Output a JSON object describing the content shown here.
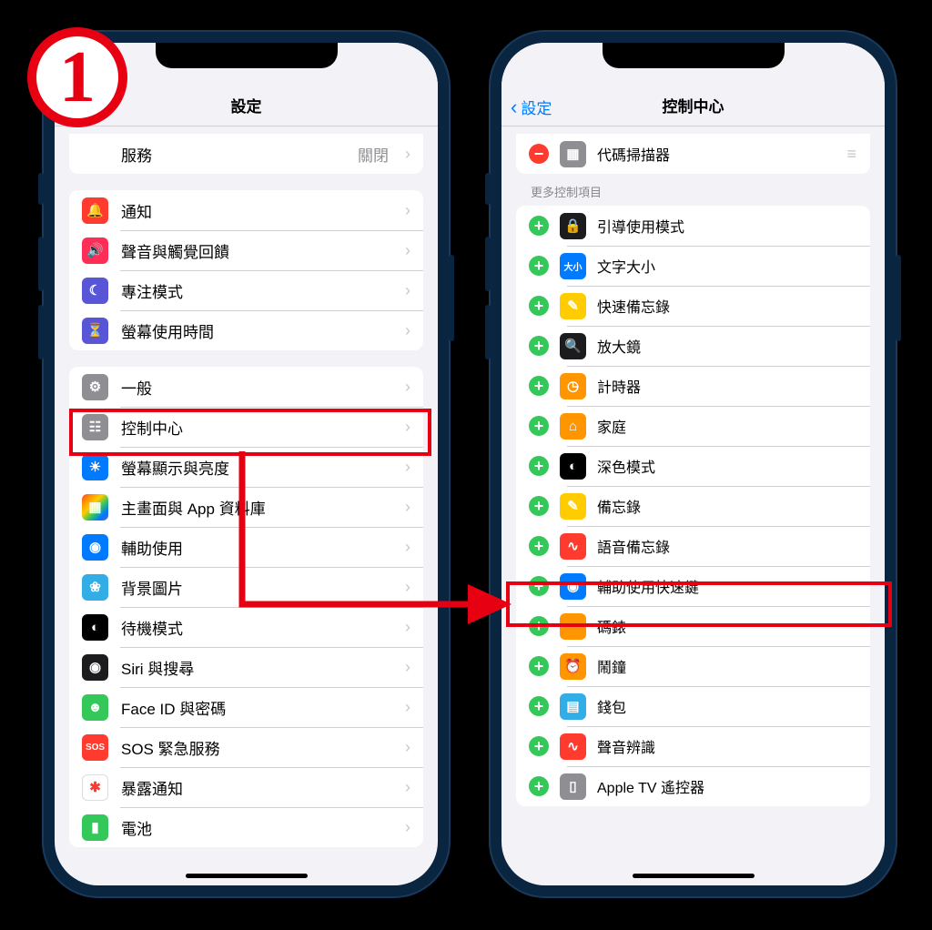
{
  "annotation": {
    "badge_number": "1"
  },
  "left_phone": {
    "title": "設定",
    "partial_row": {
      "label": "服務",
      "value": "關閉"
    },
    "group1": [
      {
        "label": "通知",
        "icon": "bell-icon",
        "color": "ic-red"
      },
      {
        "label": "聲音與觸覺回饋",
        "icon": "speaker-icon",
        "color": "ic-pink"
      },
      {
        "label": "專注模式",
        "icon": "moon-icon",
        "color": "ic-purple"
      },
      {
        "label": "螢幕使用時間",
        "icon": "hourglass-icon",
        "color": "ic-purple"
      }
    ],
    "group2": [
      {
        "label": "一般",
        "icon": "gear-icon",
        "color": "ic-gray"
      },
      {
        "label": "控制中心",
        "icon": "switches-icon",
        "color": "ic-gray",
        "highlight": true
      },
      {
        "label": "螢幕顯示與亮度",
        "icon": "brightness-icon",
        "color": "ic-blue"
      },
      {
        "label": "主畫面與 App 資料庫",
        "icon": "grid-icon",
        "color": "ic-multi"
      },
      {
        "label": "輔助使用",
        "icon": "accessibility-icon",
        "color": "ic-blue"
      },
      {
        "label": "背景圖片",
        "icon": "flower-icon",
        "color": "ic-teal"
      },
      {
        "label": "待機模式",
        "icon": "standby-icon",
        "color": "ic-black"
      },
      {
        "label": "Siri 與搜尋",
        "icon": "siri-icon",
        "color": "ic-dark"
      },
      {
        "label": "Face ID 與密碼",
        "icon": "faceid-icon",
        "color": "ic-green"
      },
      {
        "label": "SOS 緊急服務",
        "icon": "sos-icon",
        "color": "ic-red",
        "text": "SOS"
      },
      {
        "label": "暴露通知",
        "icon": "exposure-icon",
        "color": "ic-white"
      },
      {
        "label": "電池",
        "icon": "battery-icon",
        "color": "ic-green"
      }
    ]
  },
  "right_phone": {
    "back_label": "設定",
    "title": "控制中心",
    "included": [
      {
        "label": "代碼掃描器",
        "icon": "qr-icon",
        "color": "ic-gray",
        "action": "remove"
      }
    ],
    "more_section_label": "更多控制項目",
    "more": [
      {
        "label": "引導使用模式",
        "icon": "lock-icon",
        "color": "ic-dark"
      },
      {
        "label": "文字大小",
        "icon": "text-size-icon",
        "color": "ic-blue",
        "text": "大小"
      },
      {
        "label": "快速備忘錄",
        "icon": "quicknote-icon",
        "color": "ic-yellow"
      },
      {
        "label": "放大鏡",
        "icon": "magnifier-icon",
        "color": "ic-dark"
      },
      {
        "label": "計時器",
        "icon": "timer-icon",
        "color": "ic-orange"
      },
      {
        "label": "家庭",
        "icon": "home-icon",
        "color": "ic-orange"
      },
      {
        "label": "深色模式",
        "icon": "darkmode-icon",
        "color": "ic-black"
      },
      {
        "label": "備忘錄",
        "icon": "notes-icon",
        "color": "ic-yellow"
      },
      {
        "label": "語音備忘錄",
        "icon": "voice-memo-icon",
        "color": "ic-red"
      },
      {
        "label": "輔助使用快速鍵",
        "icon": "accessibility-shortcut-icon",
        "color": "ic-blue",
        "highlight": true
      },
      {
        "label": "碼錶",
        "icon": "stopwatch-icon",
        "color": "ic-orange"
      },
      {
        "label": "鬧鐘",
        "icon": "alarm-icon",
        "color": "ic-orange"
      },
      {
        "label": "錢包",
        "icon": "wallet-icon",
        "color": "ic-teal"
      },
      {
        "label": "聲音辨識",
        "icon": "sound-recognition-icon",
        "color": "ic-red"
      },
      {
        "label": "Apple TV 遙控器",
        "icon": "remote-icon",
        "color": "ic-gray"
      }
    ]
  }
}
